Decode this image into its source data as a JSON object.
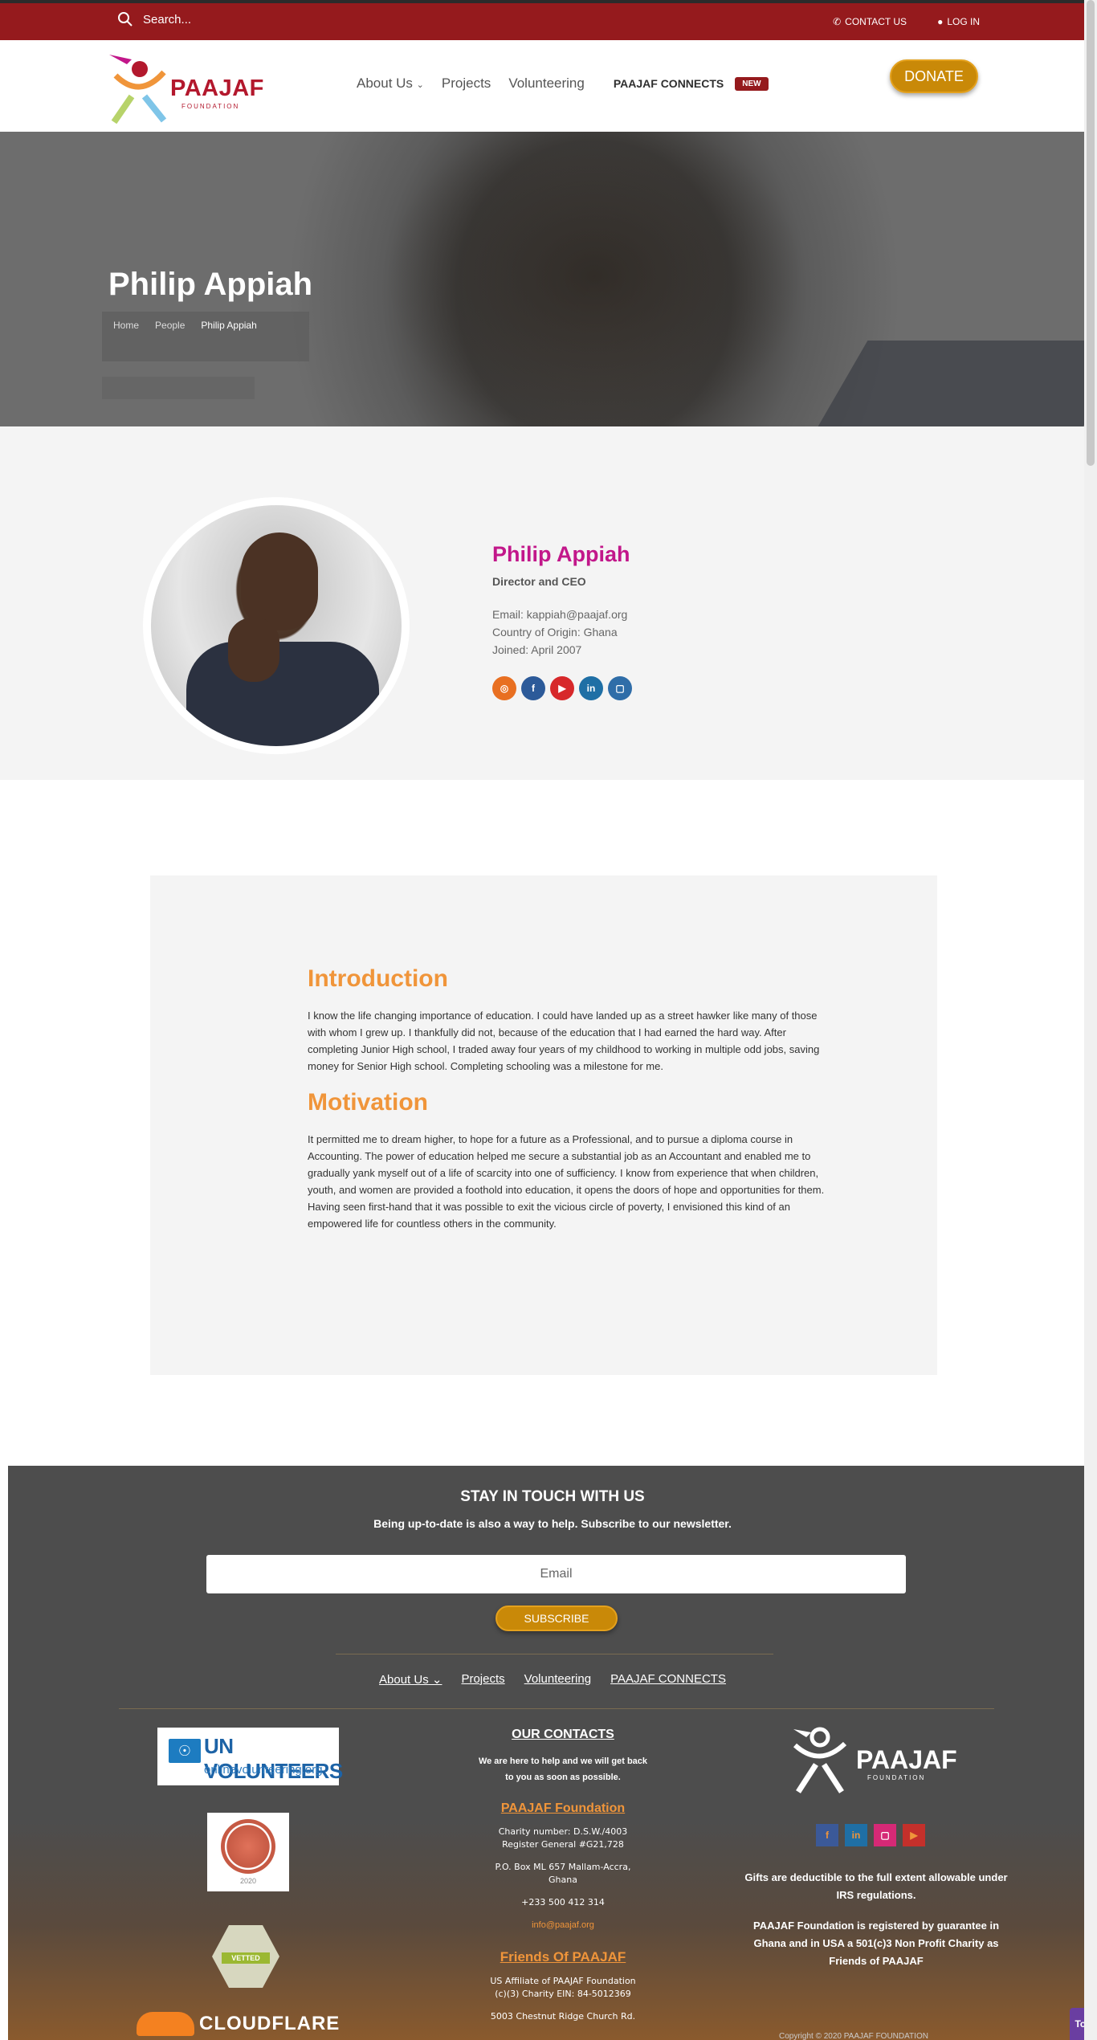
{
  "topbar": {
    "search_placeholder": "Search...",
    "contact_label": "CONTACT US",
    "login_label": "LOG IN"
  },
  "header": {
    "logo_text": "PAAJAF",
    "logo_sub": "FOUNDATION",
    "nav": {
      "about": "About Us",
      "projects": "Projects",
      "volunteering": "Volunteering",
      "connects": "PAAJAF CONNECTS",
      "badge": "NEW"
    },
    "donate_label": "DONATE"
  },
  "hero": {
    "title": "Philip Appiah",
    "breadcrumb": [
      "Home",
      "People",
      "Philip Appiah"
    ]
  },
  "profile": {
    "name": "Philip Appiah",
    "role": "Director and CEO",
    "email": "Email: kappiah@paajaf.org",
    "country": "Country of Origin: Ghana",
    "joined": "Joined: April 2007",
    "socials": [
      {
        "icon": "rss-icon",
        "glyph": "◎",
        "color": "#e86f21"
      },
      {
        "icon": "facebook-icon",
        "glyph": "f",
        "color": "#2c5a99"
      },
      {
        "icon": "youtube-icon",
        "glyph": "▶",
        "color": "#d7282a"
      },
      {
        "icon": "linkedin-icon",
        "glyph": "in",
        "color": "#1f6fa5"
      },
      {
        "icon": "instagram-icon",
        "glyph": "▢",
        "color": "#2f6da8"
      }
    ]
  },
  "article": {
    "intro_heading": "Introduction",
    "intro_text": "I know the life changing importance of education. I could have landed up as a street hawker like many of those with whom I grew up. I thankfully did not, because of the education that I had earned the hard way. After completing Junior High school, I traded away four years of my childhood to working in multiple odd jobs, saving money for Senior High school. Completing schooling was a milestone for me.",
    "motivation_heading": "Motivation",
    "motivation_text": "It permitted me to dream higher, to hope for a future as a Professional, and to pursue a diploma course in Accounting. The power of education helped me secure a substantial job as an Accountant and enabled me to gradually yank myself out of a life of scarcity into one of sufficiency. I know from experience that when children, youth, and women are provided a foothold into education, it opens the doors of hope and opportunities for them. Having seen first-hand that it was possible to exit the vicious circle of poverty, I envisioned this kind of an empowered life for countless others in the community."
  },
  "footer": {
    "stay_title": "STAY IN TOUCH WITH US",
    "stay_sub": "Being up-to-date is also a way to help. Subscribe to our newsletter.",
    "email_placeholder": "Email",
    "subscribe_label": "SUBSCRIBE",
    "nav": [
      "About Us",
      "Projects",
      "Volunteering",
      "PAAJAF CONNECTS"
    ],
    "unv": {
      "t1": "UN VOLUNTEERS",
      "t2": "onlinevolunteering.org"
    },
    "seal_year": "2020",
    "vetted_label": "VETTED",
    "cloudflare_label": "CLOUDFLARE",
    "contacts": {
      "heading": "OUR CONTACTS",
      "help1": "We are here to help and we will get back",
      "help2": "to you as soon as possible.",
      "org": "PAAJAF Foundation",
      "charity": "Charity number: D.S.W./4003",
      "register": "Register General #G21,728",
      "address1": "P.O. Box ML 657 Mallam-Accra,",
      "address2": "Ghana",
      "phone": "+233 500 412 314",
      "mail": "info@paajaf.org",
      "friends": "Friends Of PAAJAF",
      "us1": "US Affiliate of PAAJAF Foundation",
      "us2": "(c)(3) Charity EIN: 84-5012369",
      "us3": "5003 Chestnut Ridge Church Rd."
    },
    "brand": {
      "word": "PAAJAF",
      "sub": "FOUNDATION"
    },
    "socials": [
      {
        "icon": "facebook-icon",
        "glyph": "f",
        "bg": "#3b5998",
        "fg": "#f0953a"
      },
      {
        "icon": "linkedin-icon",
        "glyph": "in",
        "bg": "#1f6fa5",
        "fg": "#f0953a"
      },
      {
        "icon": "instagram-icon",
        "glyph": "▢",
        "bg": "#d62976",
        "fg": "#ffffff"
      },
      {
        "icon": "youtube-icon",
        "glyph": "▶",
        "bg": "#c4302b",
        "fg": "#f0953a"
      }
    ],
    "gifts": "Gifts are deductible to the full extent allowable under IRS regulations.",
    "registered": "PAAJAF Foundation is registered by guarantee in Ghana and in USA a 501(c)3 Non Profit Charity as Friends of PAAJAF",
    "copyright": "Copyright © 2020 PAAJAF FOUNDATION",
    "totop": "Top"
  }
}
